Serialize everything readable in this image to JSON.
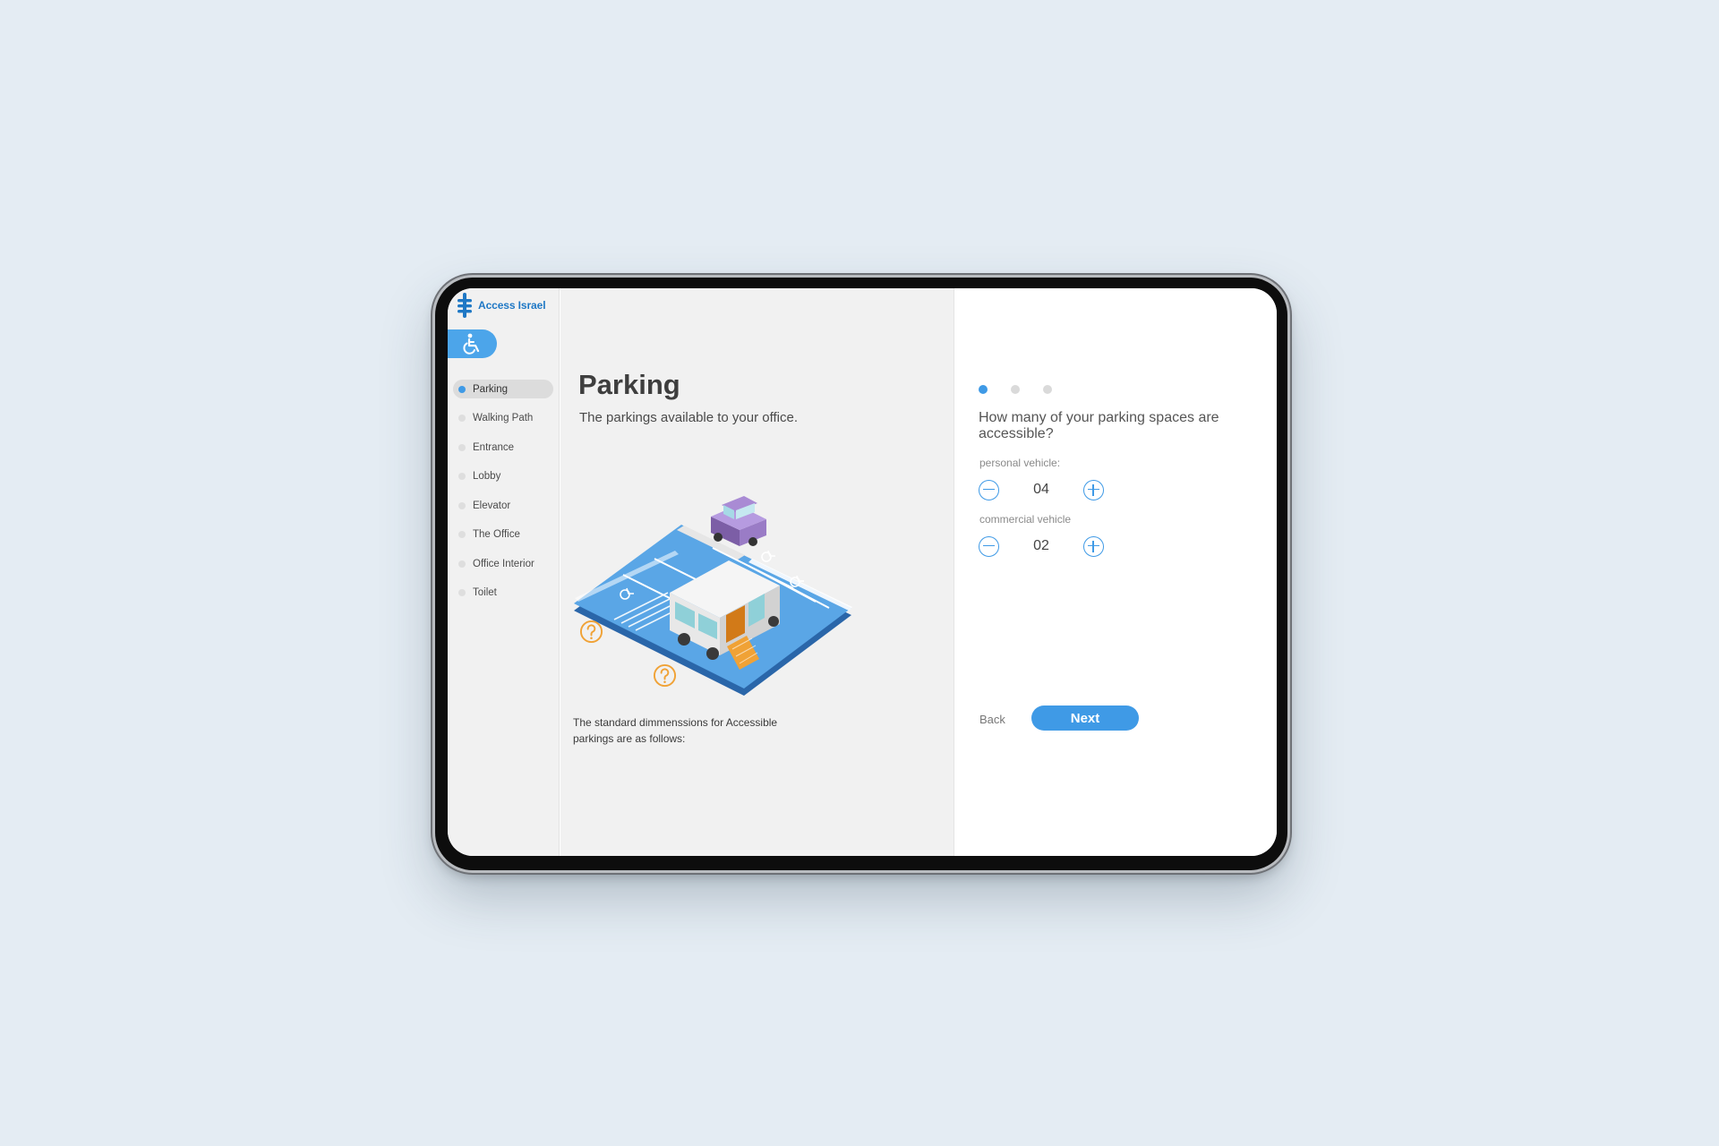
{
  "brand": {
    "name": "Access Israel",
    "color": "#1f78c5"
  },
  "accent_color": "#3f9ae6",
  "sidebar": {
    "items": [
      {
        "label": "Parking",
        "active": true
      },
      {
        "label": "Walking Path",
        "active": false
      },
      {
        "label": "Entrance",
        "active": false
      },
      {
        "label": "Lobby",
        "active": false
      },
      {
        "label": "Elevator",
        "active": false
      },
      {
        "label": "The Office",
        "active": false
      },
      {
        "label": "Office Interior",
        "active": false
      },
      {
        "label": "Toilet",
        "active": false
      }
    ]
  },
  "main": {
    "title": "Parking",
    "subtitle": "The parkings available to your office.",
    "note_line1": "The standard dimmenssions for Accessible",
    "note_line2": "parkings are  as follows:",
    "illustration_icon": "accessible-parking-lot-illustration",
    "help_icon": "question-mark-icon"
  },
  "form": {
    "step_current": 1,
    "step_total": 3,
    "question": "How many of your parking spaces are accessible?",
    "personal_label": "personal vehicle:",
    "personal_value": "04",
    "commercial_label": "commercial vehicle",
    "commercial_value": "02",
    "back_label": "Back",
    "next_label": "Next"
  }
}
